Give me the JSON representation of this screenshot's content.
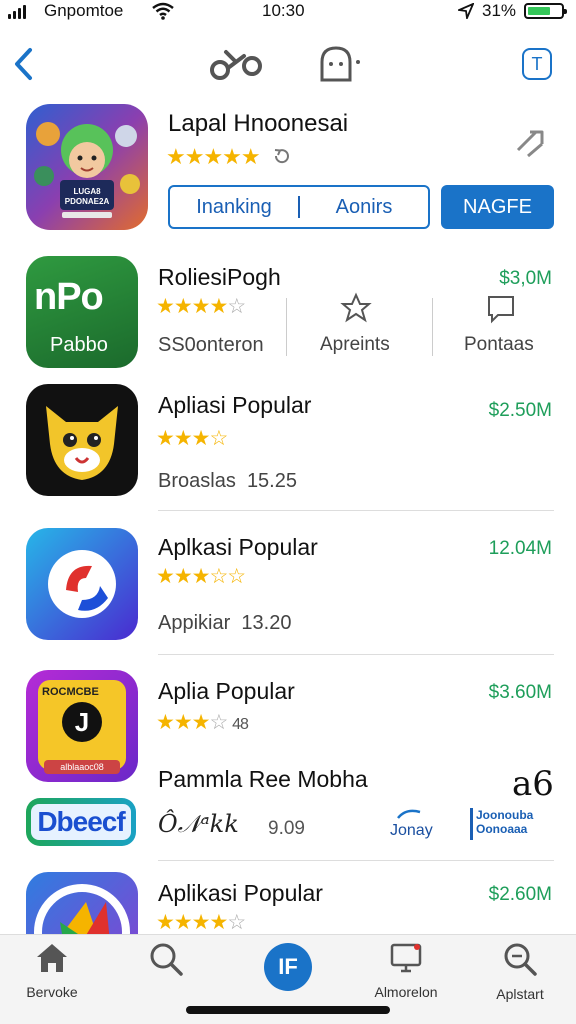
{
  "status": {
    "carrier": "Gnpomtoe",
    "time": "10:30",
    "battery_pct": "31%",
    "battery_level": 0.7
  },
  "nav": {
    "back_icon": "chevron-left-icon",
    "share_icon": "share-icon",
    "ghost_icon": "ghost-icon",
    "t_button_label": "T"
  },
  "hero": {
    "title": "Lapal Hnoonesai",
    "rating": 5,
    "segment_left": "Inanking",
    "segment_right": "Aonirs",
    "get_label": "NAGFE",
    "icon_caption": "PDONAE2A"
  },
  "rows": [
    {
      "title": "RoliesiPogh",
      "price": "$3,0M",
      "stars": "★★★★",
      "empty": "☆",
      "sub": "SS0onteron",
      "col2": "Apreints",
      "col3": "Pontaas",
      "icon_text": "nPo",
      "icon_sub": "Pabbo"
    },
    {
      "title": "Apliasi Popular",
      "price": "$2.50M",
      "stars": "★★★",
      "empty": "☆",
      "sub": "Broaslas",
      "count": "15.25"
    },
    {
      "title": "Aplkasi Popular",
      "price": "12.04M",
      "stars": "★★★",
      "empty": "☆☆",
      "sub": "Appikiar",
      "count": "13.20"
    },
    {
      "title": "Aplia Popular",
      "price": "$3.60M",
      "stars": "★★★",
      "empty": "☆",
      "count": "48",
      "icon_text": "ROCMCBE",
      "icon_letter": "J",
      "icon_sub": "alblaaoc08"
    },
    {
      "title": "Aplikasi Popular",
      "price": "$2.60M",
      "stars": "★★★★",
      "empty": "☆"
    }
  ],
  "promo": {
    "title": "Pammla Ree  Mobha",
    "badge": "Dbeecf",
    "signature": "Ô𝒩ᵃkk",
    "value": "9.09",
    "link": "Jonay",
    "logo_top": "Joonouba",
    "logo_bottom": "Oonoaaa",
    "corner": "a6"
  },
  "tabs": [
    {
      "label": "Bervoke",
      "icon": "home-icon"
    },
    {
      "label": "",
      "icon": "search-icon"
    },
    {
      "label": "IF",
      "icon": "center-app-icon"
    },
    {
      "label": "Almorelon",
      "icon": "display-icon"
    },
    {
      "label": "Aplstart",
      "icon": "search-apps-icon"
    }
  ]
}
